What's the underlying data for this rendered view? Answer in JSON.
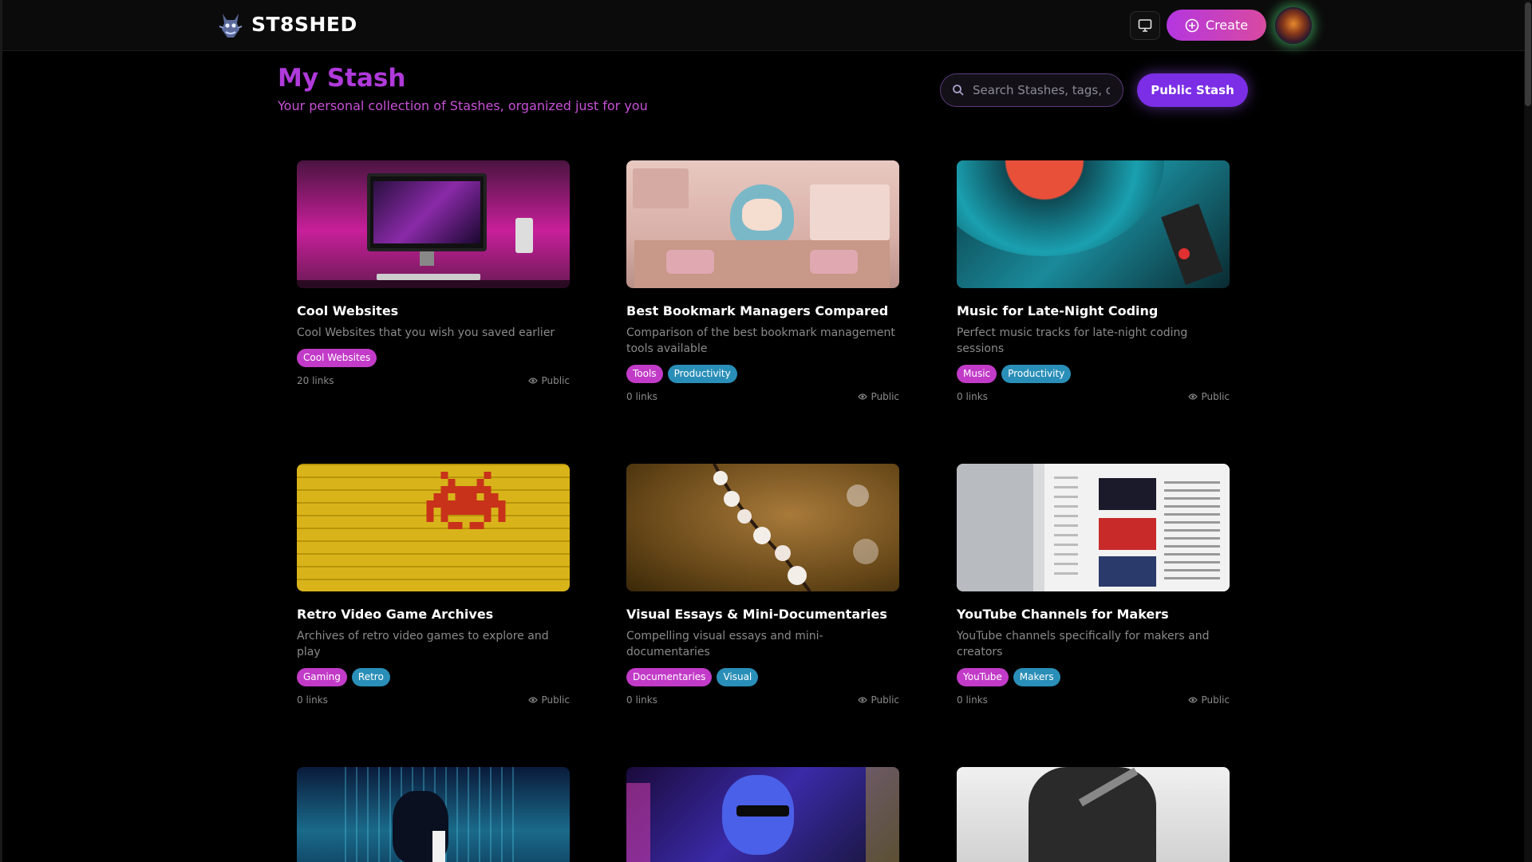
{
  "header": {
    "brand": "ST8SHED",
    "create_label": "Create"
  },
  "page": {
    "title": "My Stash",
    "subtitle": "Your personal collection of Stashes, organized just for you",
    "search_placeholder": "Search Stashes, tags, or",
    "public_button": "Public Stash"
  },
  "cards": [
    {
      "title": "Cool Websites",
      "description": "Cool Websites that you wish you saved earlier",
      "tags": [
        {
          "label": "Cool Websites",
          "color": "pink"
        }
      ],
      "links": "20 links",
      "visibility": "Public"
    },
    {
      "title": "Best Bookmark Managers Compared",
      "description": "Comparison of the best bookmark management tools available",
      "tags": [
        {
          "label": "Tools",
          "color": "pink"
        },
        {
          "label": "Productivity",
          "color": "blue"
        }
      ],
      "links": "0 links",
      "visibility": "Public"
    },
    {
      "title": "Music for Late-Night Coding",
      "description": "Perfect music tracks for late-night coding sessions",
      "tags": [
        {
          "label": "Music",
          "color": "pink"
        },
        {
          "label": "Productivity",
          "color": "blue"
        }
      ],
      "links": "0 links",
      "visibility": "Public"
    },
    {
      "title": "Retro Video Game Archives",
      "description": "Archives of retro video games to explore and play",
      "tags": [
        {
          "label": "Gaming",
          "color": "pink"
        },
        {
          "label": "Retro",
          "color": "blue"
        }
      ],
      "links": "0 links",
      "visibility": "Public"
    },
    {
      "title": "Visual Essays & Mini-Documentaries",
      "description": "Compelling visual essays and mini-documentaries",
      "tags": [
        {
          "label": "Documentaries",
          "color": "pink"
        },
        {
          "label": "Visual",
          "color": "blue"
        }
      ],
      "links": "0 links",
      "visibility": "Public"
    },
    {
      "title": "YouTube Channels for Makers",
      "description": "YouTube channels specifically for makers and creators",
      "tags": [
        {
          "label": "YouTube",
          "color": "pink"
        },
        {
          "label": "Makers",
          "color": "blue"
        }
      ],
      "links": "0 links",
      "visibility": "Public"
    },
    {
      "title": "",
      "description": "",
      "tags": [],
      "links": "",
      "visibility": ""
    },
    {
      "title": "",
      "description": "",
      "tags": [],
      "links": "",
      "visibility": ""
    },
    {
      "title": "",
      "description": "",
      "tags": [],
      "links": "",
      "visibility": ""
    }
  ],
  "colors": {
    "accent_purple": "#b03adb",
    "tag_pink": "#c23bc8",
    "tag_blue": "#2a8fb8",
    "button_purple": "#7b2ee6"
  }
}
